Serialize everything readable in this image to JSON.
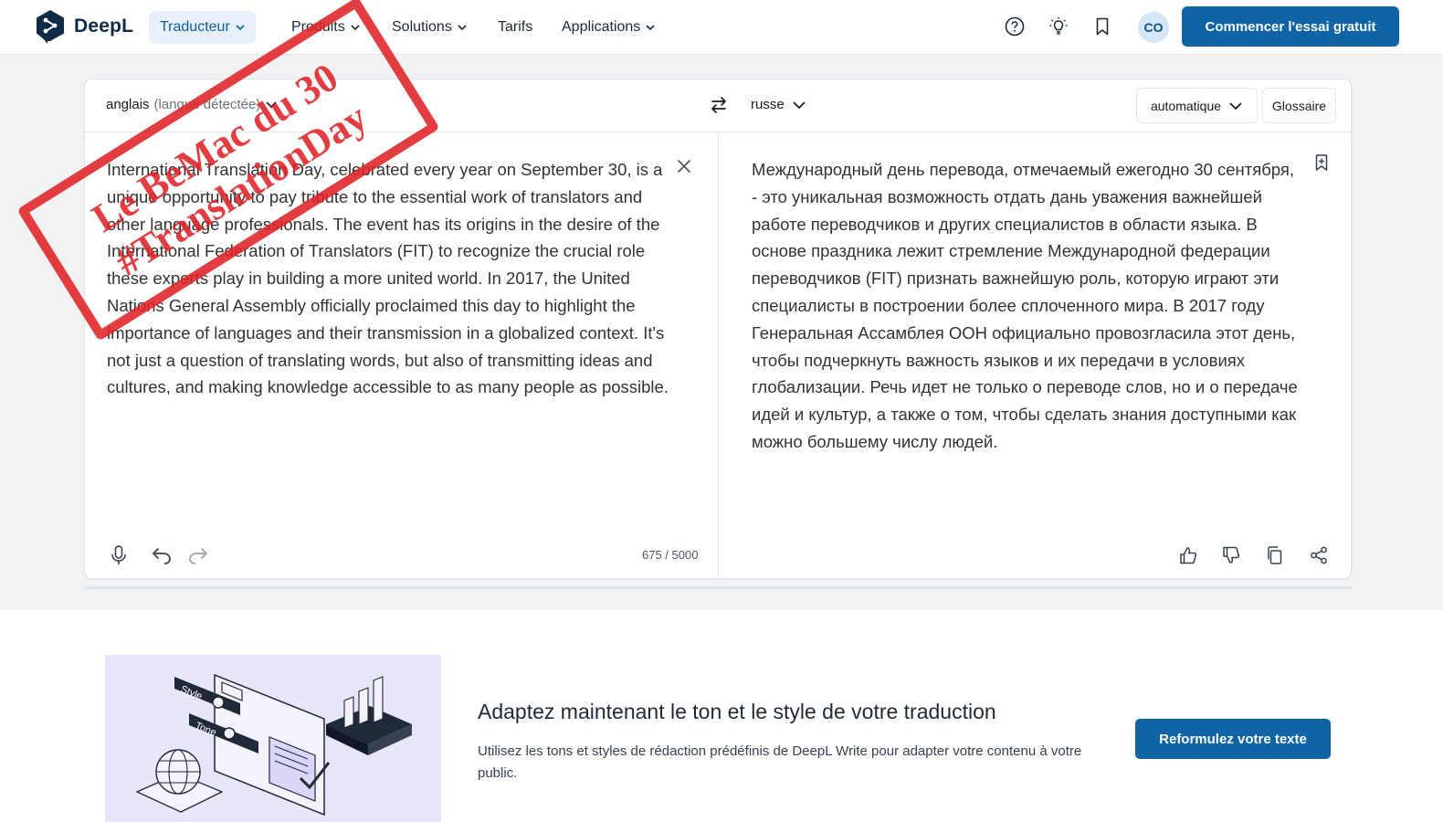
{
  "header": {
    "brand": "DeepL",
    "nav": [
      {
        "label": "Traducteur",
        "dropdown": true
      },
      {
        "label": "Produits",
        "dropdown": true
      },
      {
        "label": "Solutions",
        "dropdown": true
      },
      {
        "label": "Tarifs",
        "dropdown": false
      },
      {
        "label": "Applications",
        "dropdown": true
      }
    ],
    "icons": [
      "help-icon",
      "lightbulb-icon",
      "bookmark-icon"
    ],
    "avatar_initials": "CO",
    "cta_label": "Commencer l'essai gratuit"
  },
  "translator": {
    "source_language": "anglais",
    "source_detected": "(langue détectée)",
    "target_language": "russe",
    "formality": "automatique",
    "glossary_label": "Glossaire",
    "source_text": "International Translation Day, celebrated every year on September 30, is a unique opportunity to pay tribute to the essential work of translators and other language professionals. The event has its origins in the desire of the International Federation of Translators (FIT) to recognize the crucial role these experts play in building a more united world. In 2017, the United Nations General Assembly officially proclaimed this day to highlight the importance of languages and their transmission in a globalized context. It's not just a question of translating words, but also of transmitting ideas and cultures, and making knowledge accessible to as many people as possible.",
    "target_text": "Международный день перевода, отмечаемый ежегодно 30 сентября, - это уникальная возможность отдать дань уважения важнейшей работе переводчиков и других специалистов в области языка. В основе праздника лежит стремление Международной федерации переводчиков (FIT) признать важнейшую роль, которую играют эти специалисты в построении более сплоченного мира. В 2017 году Генеральная Ассамблея ООН официально провозгласила этот день, чтобы подчеркнуть важность языков и их передачи в условиях глобализации. Речь идет не только о переводе слов, но и о передаче идей и культур, а также о том, чтобы сделать знания доступными как можно большему числу людей.",
    "char_count": "675 / 5000"
  },
  "stamp": {
    "line1": "Le BeMac du 30",
    "line2": "#TranslationDay",
    "color": "#e02327"
  },
  "promo": {
    "title": "Adaptez maintenant le ton et le style de votre traduction",
    "description": "Utilisez les tons et styles de rédaction prédéfinis de DeepL Write pour adapter votre contenu à votre public.",
    "button_label": "Reformulez votre texte",
    "illustration_labels": [
      "Style",
      "Tone"
    ]
  },
  "colors": {
    "brand_blue": "#0f64a6",
    "nav_active_bg": "#e8f1fb",
    "page_bg": "#f1f2f4"
  }
}
